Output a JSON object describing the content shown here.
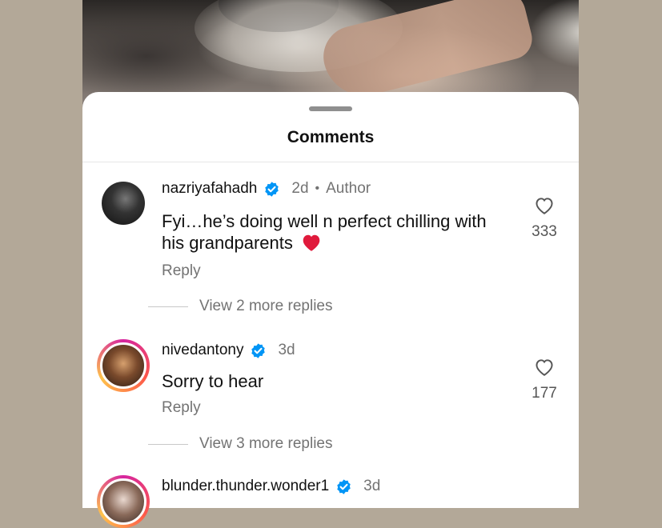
{
  "sheet": {
    "title": "Comments"
  },
  "comments": [
    {
      "username": "nazriyafahadh",
      "time": "2d",
      "separator": "•",
      "tag": "Author",
      "text": "Fyi…he’s doing well n perfect chilling with his grandparents",
      "emoji": "red-heart-icon",
      "reply_label": "Reply",
      "view_replies": "View 2 more replies",
      "likes": "333"
    },
    {
      "username": "nivedantony",
      "time": "3d",
      "text": "Sorry to hear",
      "reply_label": "Reply",
      "view_replies": "View 3 more replies",
      "likes": "177"
    },
    {
      "username": "blunder.thunder.wonder1",
      "time": "3d"
    }
  ],
  "colors": {
    "verified": "#0095f6",
    "heart": "#e01a3c",
    "muted": "#737373"
  }
}
